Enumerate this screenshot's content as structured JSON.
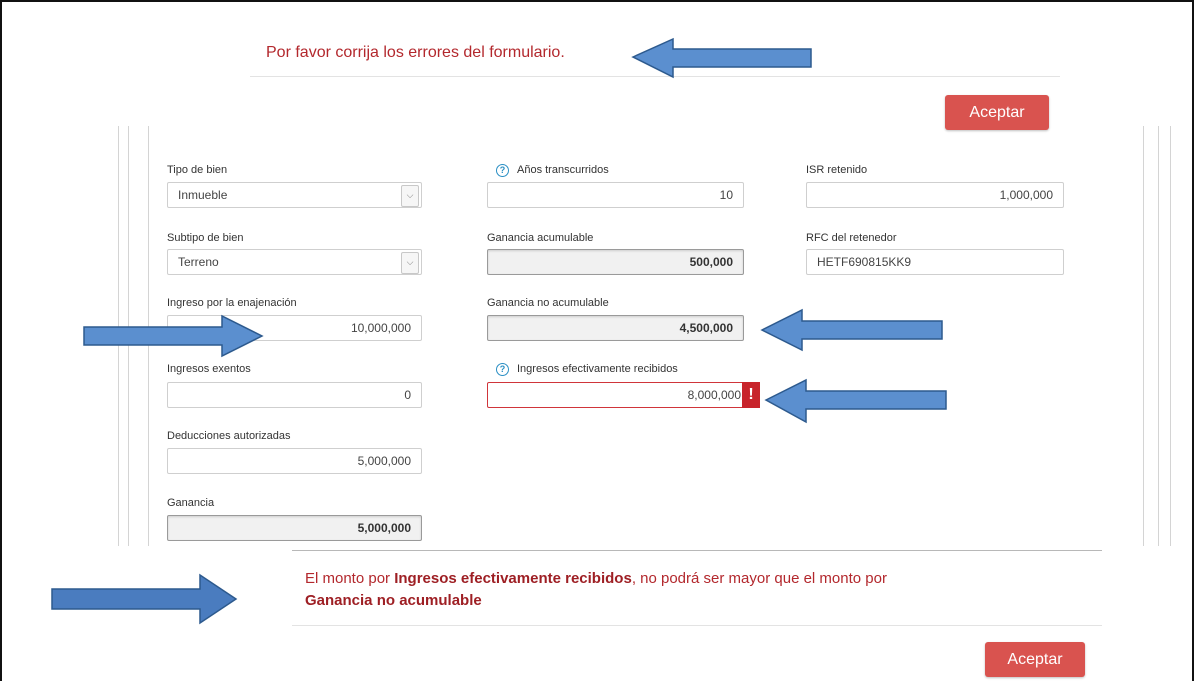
{
  "top_message": "Por favor corrija los errores del formulario.",
  "accept_label": "Aceptar",
  "fields": {
    "tipo_bien": {
      "label": "Tipo de bien",
      "value": "Inmueble"
    },
    "subtipo_bien": {
      "label": "Subtipo de bien",
      "value": "Terreno"
    },
    "ingreso_enajenacion": {
      "label": "Ingreso por la enajenación",
      "value": "10,000,000"
    },
    "ingresos_exentos": {
      "label": "Ingresos exentos",
      "value": "0"
    },
    "deducciones": {
      "label": "Deducciones autorizadas",
      "value": "5,000,000"
    },
    "ganancia": {
      "label": "Ganancia",
      "value": "5,000,000"
    },
    "anios": {
      "label": "Años transcurridos",
      "value": "10"
    },
    "ganancia_acumulable": {
      "label": "Ganancia acumulable",
      "value": "500,000"
    },
    "ganancia_no_acumulable": {
      "label": "Ganancia no acumulable",
      "value": "4,500,000"
    },
    "ingresos_recibidos": {
      "label": "Ingresos efectivamente recibidos",
      "value": "8,000,000"
    },
    "isr_retenido": {
      "label": "ISR retenido",
      "value": "1,000,000"
    },
    "rfc_retenedor": {
      "label": "RFC del retenedor",
      "value": "HETF690815KK9"
    }
  },
  "error_badge": "!",
  "bottom_message": {
    "part1": "El monto por ",
    "bold1": "Ingresos efectivamente recibidos",
    "part2": ", no podrá ser mayor que el monto por",
    "bold2": "Ganancia no acumulable"
  },
  "colors": {
    "error_text": "#b3282d",
    "accept_button": "#d9534f",
    "arrow_fill": "#5b8fcf",
    "arrow_stroke": "#2d5a8e",
    "help_icon": "#2a8fc4"
  },
  "icons": [
    "help-icon",
    "chevron-down-icon",
    "error-icon",
    "arrow-right-icon",
    "arrow-left-icon"
  ]
}
